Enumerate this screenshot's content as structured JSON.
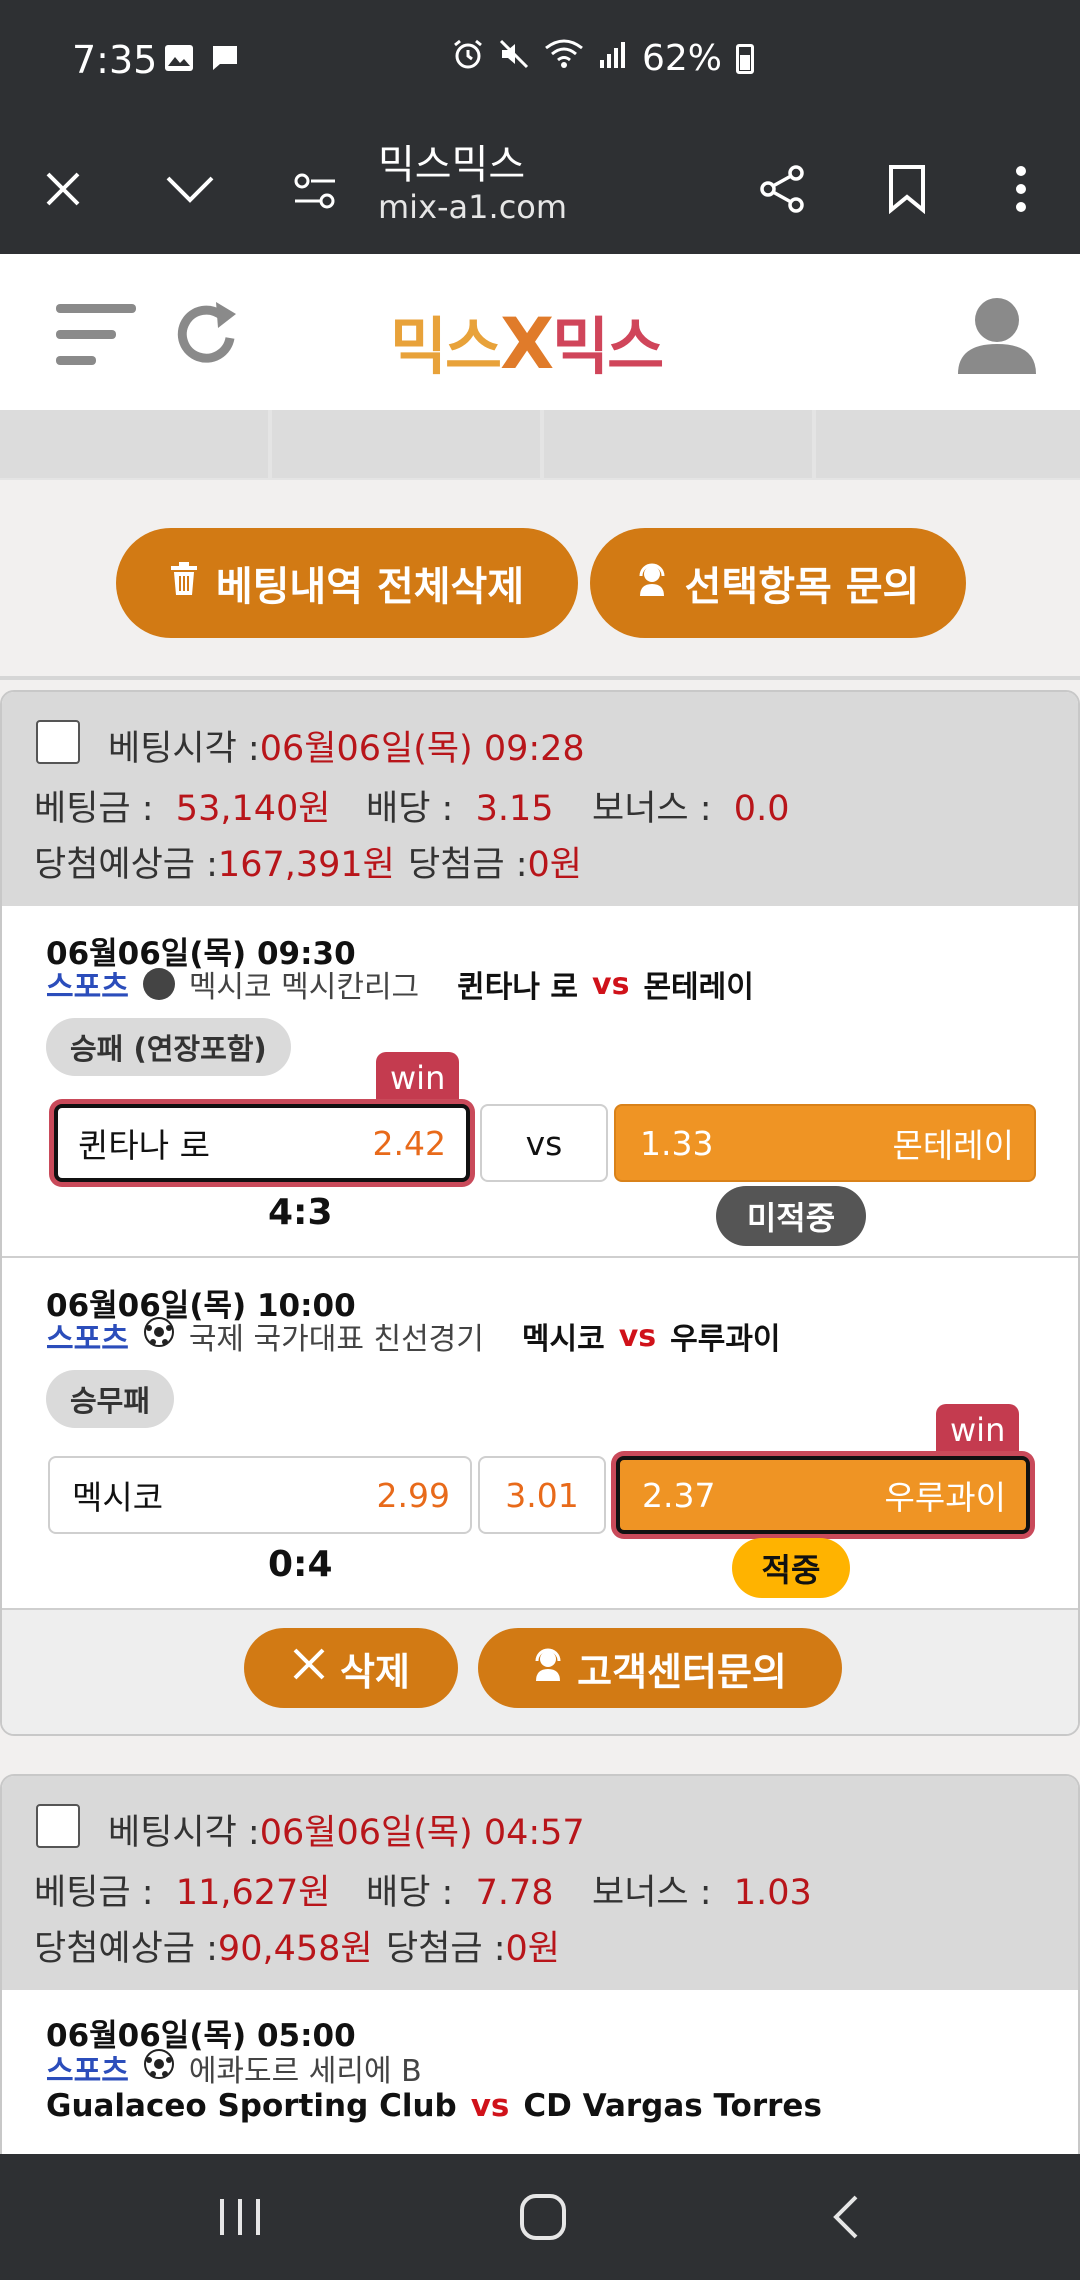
{
  "status_bar": {
    "time": "7:35",
    "battery": "62%"
  },
  "browser": {
    "title": "믹스믹스",
    "url": "mix-a1.com"
  },
  "site": {
    "logo_left": "믹스",
    "logo_x": "X",
    "logo_right": "믹스"
  },
  "actions": {
    "delete_all": "베팅내역 전체삭제",
    "inquire_selected": "선택항목 문의"
  },
  "bets": [
    {
      "bet_time_label": "베팅시각 :",
      "bet_time": "06월06일(목) 09:28",
      "amount_label": "베팅금 :",
      "amount": "53,140원",
      "odds_label": "배당 :",
      "odds": "3.15",
      "bonus_label": "보너스 :",
      "bonus": "0.0",
      "expected_label": "당첨예상금 :",
      "expected": "167,391원",
      "won_label": "당첨금 :",
      "won": "0원",
      "matches": [
        {
          "datetime": "06월06일(목) 09:30",
          "category": "스포츠",
          "league": "멕시코 멕시칸리그",
          "home": "퀸타나 로",
          "vs": "vs",
          "away": "몬테레이",
          "market": "승패 (연장포함)",
          "home_option": "퀸타나 로",
          "home_odds": "2.42",
          "middle": "vs",
          "away_odds": "1.33",
          "away_option": "몬테레이",
          "win_tag": "win",
          "score": "4:3",
          "result": "미적중"
        },
        {
          "datetime": "06월06일(목) 10:00",
          "category": "스포츠",
          "league": "국제 국가대표 친선경기",
          "home": "멕시코",
          "vs": "vs",
          "away": "우루과이",
          "market": "승무패",
          "home_option": "멕시코",
          "home_odds": "2.99",
          "middle": "3.01",
          "away_odds": "2.37",
          "away_option": "우루과이",
          "win_tag": "win",
          "score": "0:4",
          "result": "적중"
        }
      ],
      "delete": "삭제",
      "support": "고객센터문의"
    },
    {
      "bet_time_label": "베팅시각 :",
      "bet_time": "06월06일(목) 04:57",
      "amount_label": "베팅금 :",
      "amount": "11,627원",
      "odds_label": "배당 :",
      "odds": "7.78",
      "bonus_label": "보너스 :",
      "bonus": "1.03",
      "expected_label": "당첨예상금 :",
      "expected": "90,458원",
      "won_label": "당첨금 :",
      "won": "0원",
      "matches": [
        {
          "datetime": "06월06일(목) 05:00",
          "category": "스포츠",
          "league": "에콰도르 세리에 B",
          "home": "Gualaceo Sporting Club",
          "vs": "vs",
          "away": "CD Vargas Torres"
        }
      ]
    }
  ],
  "colors": {
    "accent": "#d27a14",
    "selected_odds": "#ef9424",
    "win_tag": "#c43b4f",
    "red_text": "#b8151a",
    "hit_badge": "#ffb300",
    "miss_badge": "#555555"
  }
}
